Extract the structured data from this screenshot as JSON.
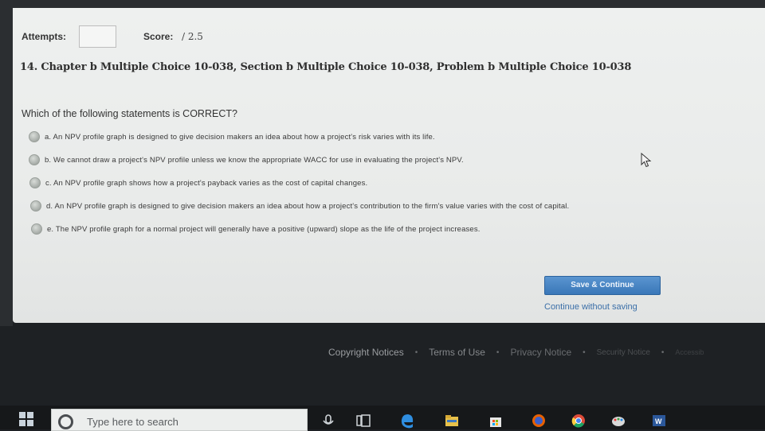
{
  "header": {
    "attempts_label": "Attempts:",
    "attempts_value": "",
    "score_label": "Score:",
    "score_value": "/ 2.5"
  },
  "question": {
    "title": "14. Chapter b Multiple Choice 10-038, Section b Multiple Choice 10-038, Problem b Multiple Choice 10-038",
    "prompt": "Which of the following statements is CORRECT?",
    "choices": [
      {
        "label": "a. An NPV profile graph is designed to give decision makers an idea about how a project's risk varies with its life."
      },
      {
        "label": "b. We cannot draw a project's NPV profile unless we know the appropriate WACC for use in evaluating the project's NPV."
      },
      {
        "label": "c. An NPV profile graph shows how a project's payback varies as the cost of capital changes."
      },
      {
        "label": "d. An NPV profile graph is designed to give decision makers an idea about how a project's contribution to the firm's value varies with the cost of capital."
      },
      {
        "label": "e. The NPV profile graph for a normal project will generally have a positive (upward) slope as the life of the project increases."
      }
    ]
  },
  "actions": {
    "save_label": "Save & Continue",
    "continue_label": "Continue without saving"
  },
  "footer": {
    "links": [
      "Copyright Notices",
      "Terms of Use",
      "Privacy Notice",
      "Security Notice",
      "Accessib"
    ]
  },
  "taskbar": {
    "search_placeholder": "Type here to search",
    "icons": [
      "windows-start-icon",
      "cortana-icon",
      "task-view-icon",
      "edge-icon",
      "file-explorer-icon",
      "store-icon",
      "firefox-icon",
      "chrome-icon",
      "paint-icon",
      "word-icon"
    ]
  },
  "colors": {
    "accent": "#3a77b8",
    "panel_bg": "#eceeed",
    "page_bg": "#1e2124"
  }
}
